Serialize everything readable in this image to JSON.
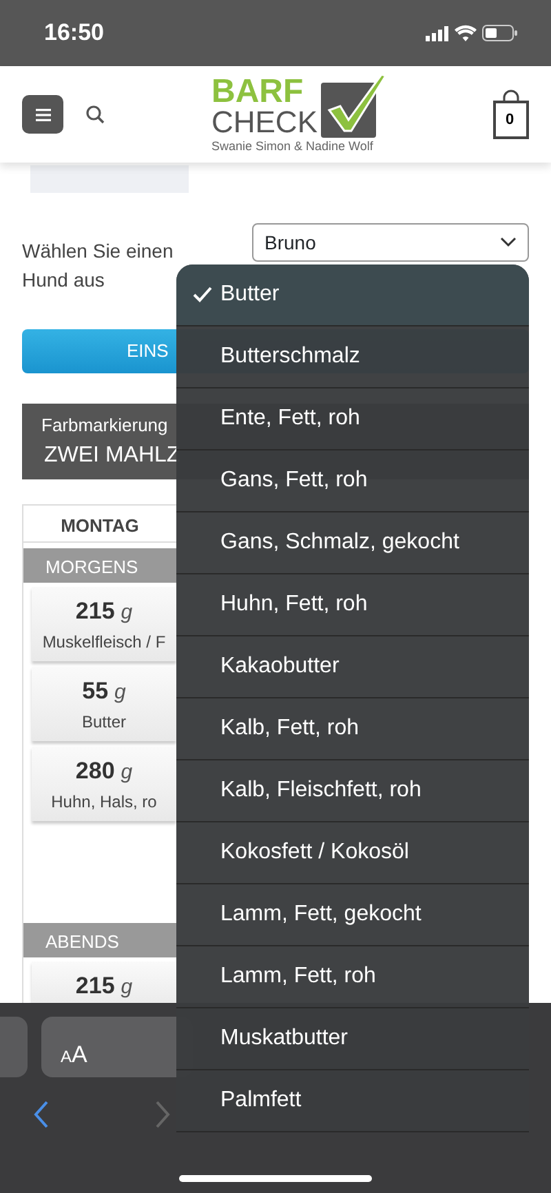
{
  "status_bar": {
    "time": "16:50"
  },
  "header": {
    "logo": {
      "top": "BARF",
      "bottom": "CHECK",
      "tagline": "Swanie Simon & Nadine Wolf"
    },
    "cart_count": "0"
  },
  "dog_select": {
    "label": "Wählen Sie einen Hund aus",
    "value": "Bruno"
  },
  "submit_button": "EINS",
  "color_panel": {
    "title": "Farbmarkierung",
    "value": "ZWEI MAHLZ"
  },
  "plan": {
    "day": "MONTAG",
    "meals": [
      {
        "name": "MORGENS",
        "items": [
          {
            "amount": "215",
            "unit": "g",
            "food": "Muskelfleisch / F"
          },
          {
            "amount": "55",
            "unit": "g",
            "food": "Butter"
          },
          {
            "amount": "280",
            "unit": "g",
            "food": "Huhn, Hals, ro"
          }
        ]
      },
      {
        "name": "ABENDS",
        "items": [
          {
            "amount": "215",
            "unit": "g"
          }
        ]
      }
    ]
  },
  "dropdown": {
    "options": [
      {
        "label": "Butter",
        "selected": true
      },
      {
        "label": "Butterschmalz",
        "selected": false
      },
      {
        "label": "Ente, Fett, roh",
        "selected": false
      },
      {
        "label": "Gans, Fett, roh",
        "selected": false
      },
      {
        "label": "Gans, Schmalz, gekocht",
        "selected": false
      },
      {
        "label": "Huhn, Fett, roh",
        "selected": false
      },
      {
        "label": "Kakaobutter",
        "selected": false
      },
      {
        "label": "Kalb, Fett, roh",
        "selected": false
      },
      {
        "label": "Kalb, Fleischfett, roh",
        "selected": false
      },
      {
        "label": "Kokosfett / Kokosöl",
        "selected": false
      },
      {
        "label": "Lamm, Fett, gekocht",
        "selected": false
      },
      {
        "label": "Lamm, Fett, roh",
        "selected": false
      },
      {
        "label": "Muskatbutter",
        "selected": false
      },
      {
        "label": "Palmfett",
        "selected": false
      }
    ]
  },
  "keyboard_bar": {
    "text_size_key": {
      "small_letter": "A",
      "large_letter": "A"
    }
  }
}
